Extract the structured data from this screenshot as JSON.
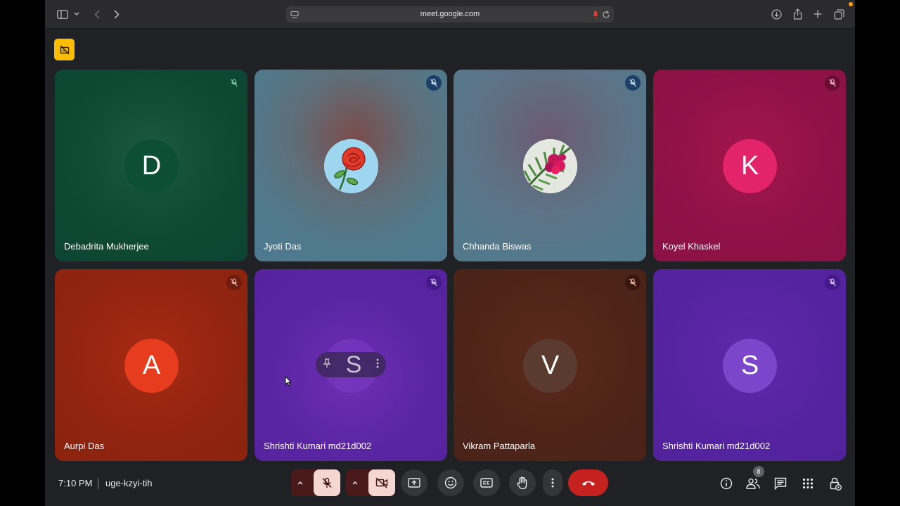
{
  "browser": {
    "url": "meet.google.com"
  },
  "tiles": [
    {
      "name": "Debadrita Mukherjee",
      "initial": "D",
      "avatar_color": "#0d4f36",
      "mic_color": "#7bd4a8"
    },
    {
      "name": "Jyoti Das",
      "initial": "",
      "avatar_type": "rose-photo",
      "mic_color": "#cfe3f0"
    },
    {
      "name": "Chhanda Biswas",
      "initial": "",
      "avatar_type": "flower-photo",
      "mic_color": "#cfe3f0"
    },
    {
      "name": "Koyel Khaskel",
      "initial": "K",
      "avatar_color": "#e3246b",
      "mic_color": "#f3b6cb"
    },
    {
      "name": "Aurpi Das",
      "initial": "A",
      "avatar_color": "#e53d1e",
      "mic_color": "#f2b8aa"
    },
    {
      "name": "Shrishti Kumari md21d002",
      "initial": "S",
      "avatar_color": "#7b3dc7",
      "mic_color": "#d7c2f3"
    },
    {
      "name": "Vikram Pattaparla",
      "initial": "V",
      "avatar_color": "#5b3a30",
      "mic_color": "#f2b8aa"
    },
    {
      "name": "Shrishti Kumari md21d002",
      "initial": "S",
      "avatar_color": "#7b46c9",
      "mic_color": "#d7c2f3"
    }
  ],
  "hover_overlay": {
    "initial": "S"
  },
  "footer": {
    "time": "7:10 PM",
    "meeting_code": "uge-kzyi-tih",
    "participants_count": "8"
  },
  "colors": {
    "hangup": "#c5221f",
    "muted_control_bg": "#f6d6d1",
    "accent_yellow": "#fbbc04"
  }
}
